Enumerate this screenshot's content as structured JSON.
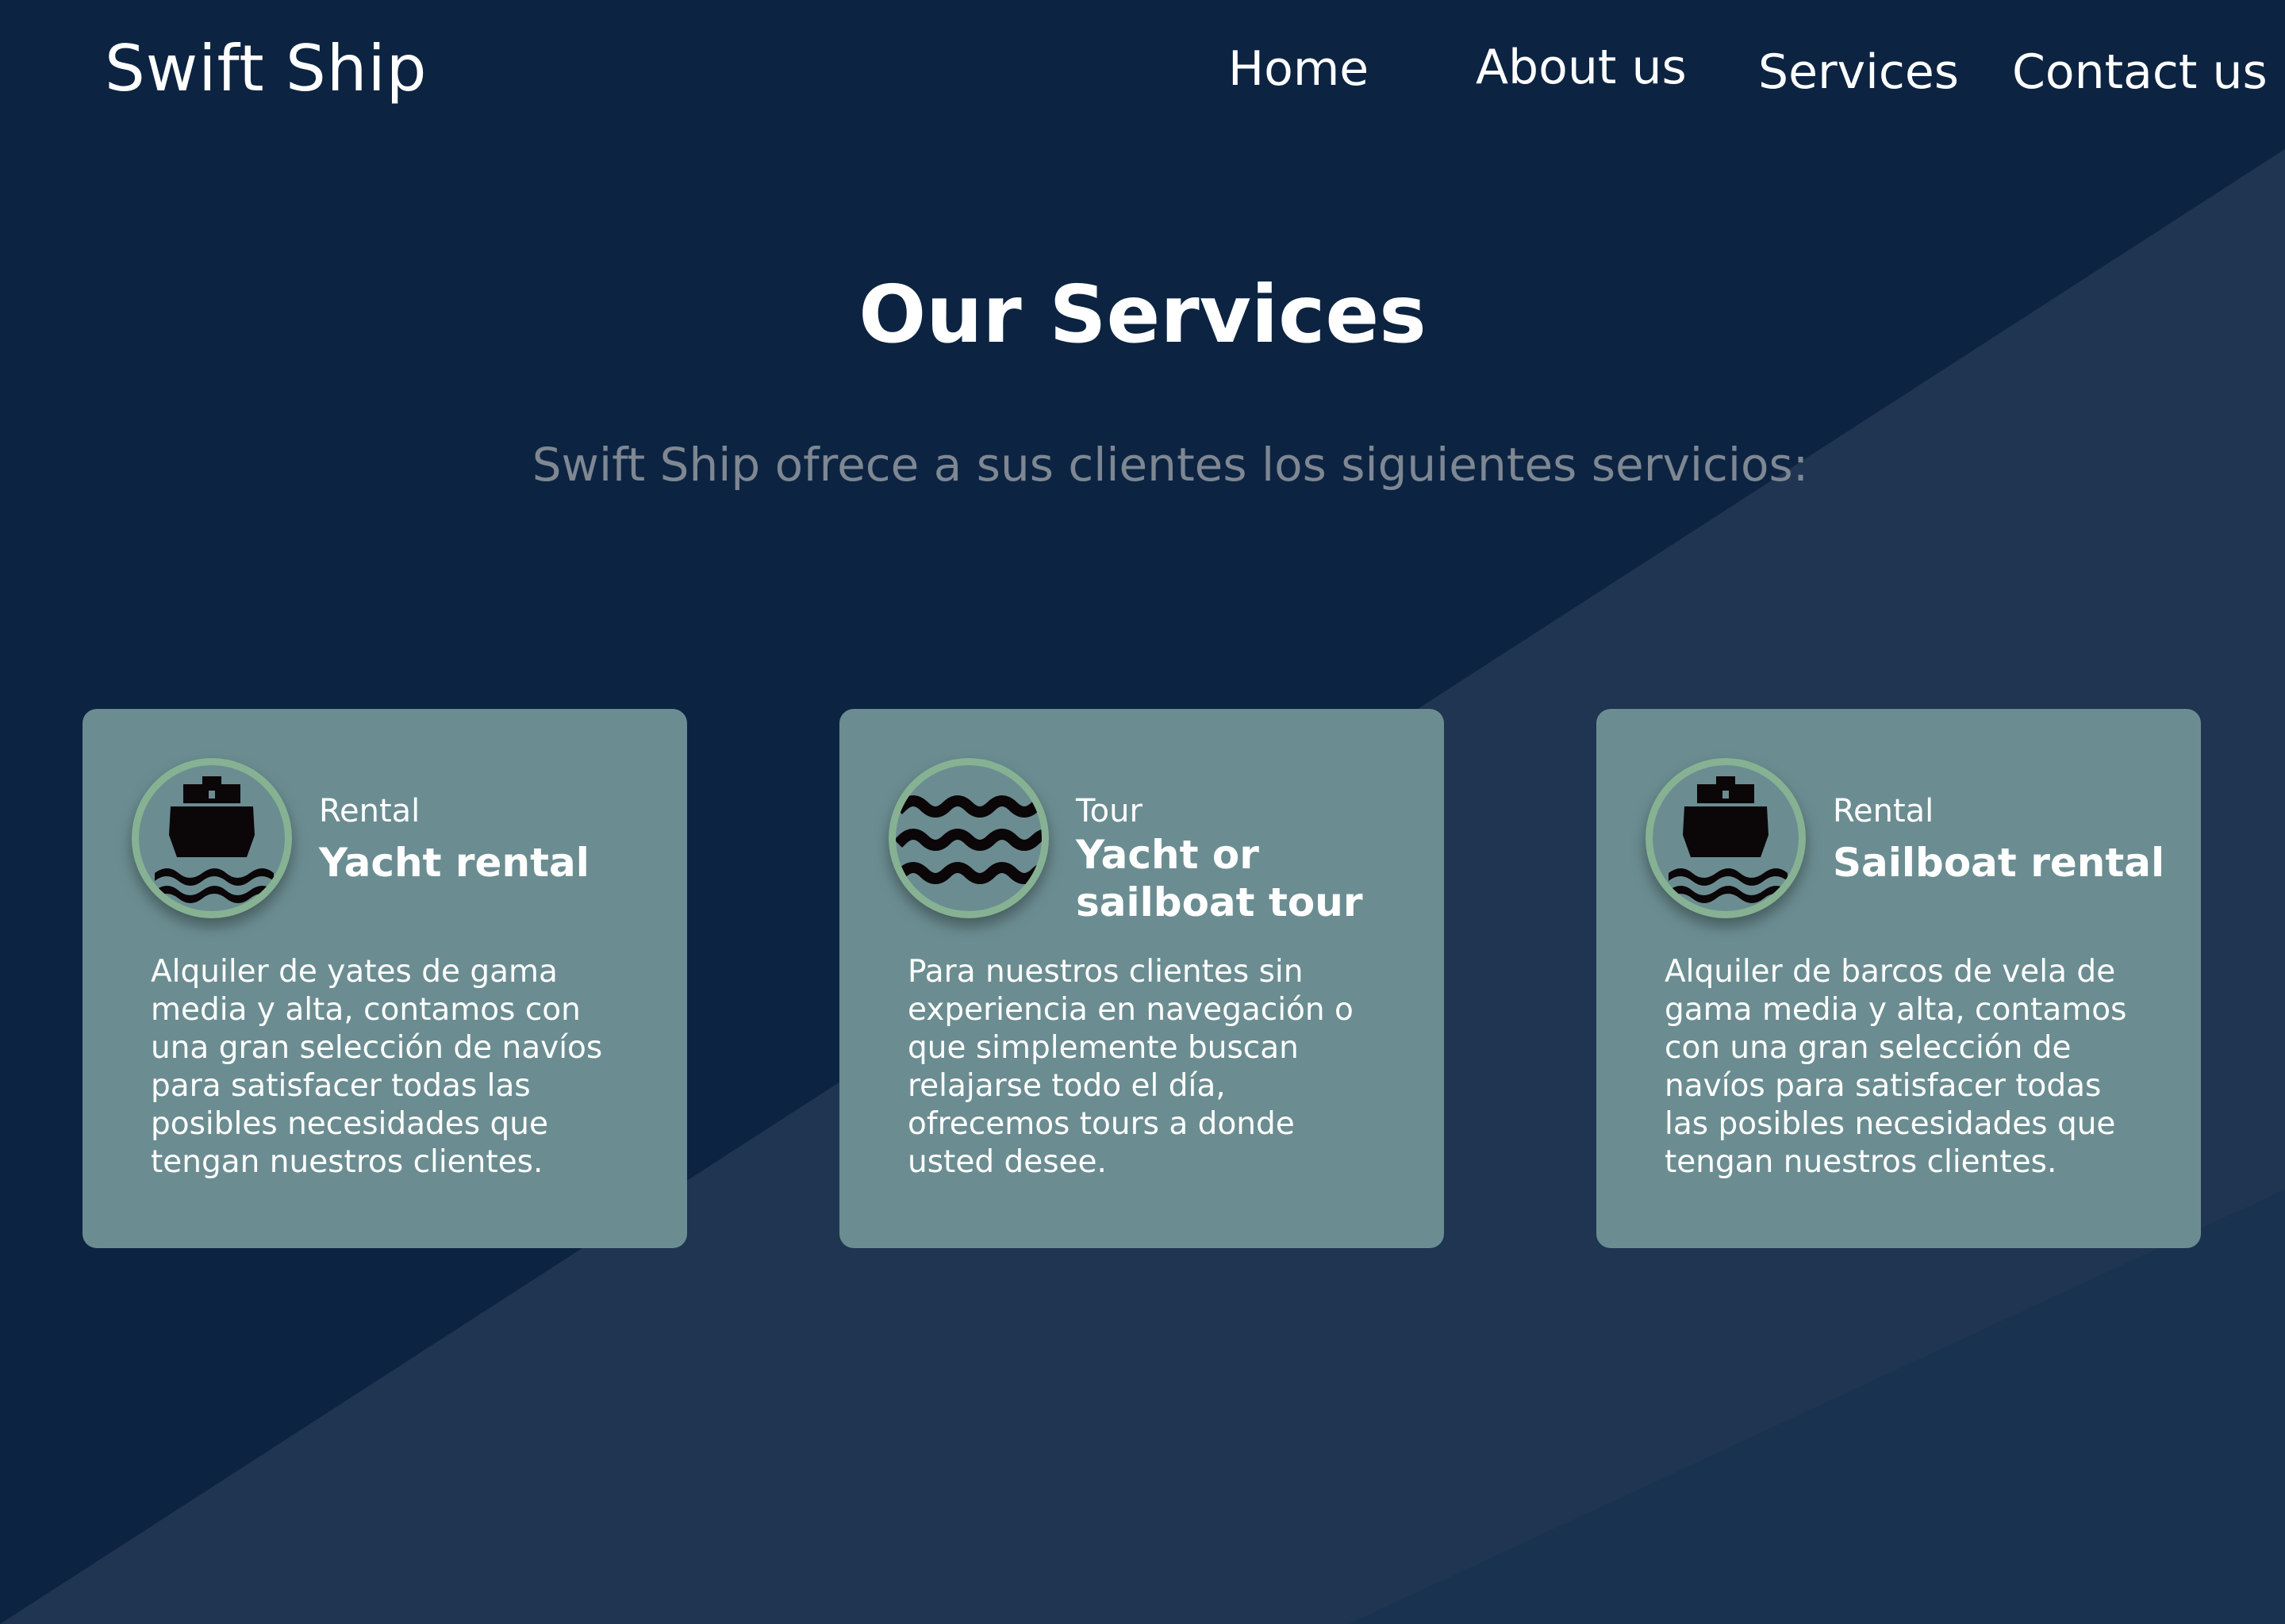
{
  "brand": {
    "name": "Swift Ship"
  },
  "nav": {
    "items": [
      "Home",
      "About us",
      "Services",
      "Contact us"
    ]
  },
  "colors": {
    "background": "#0c2442",
    "background_light": "#1f3551",
    "card": "#6b8d91",
    "icon_ring": "#86b293",
    "subtitle": "#7e8792"
  },
  "section": {
    "title": "Our Services",
    "subtitle": "Swift Ship ofrece a sus clientes los siguientes servicios:"
  },
  "cards": [
    {
      "icon": "ship-icon",
      "category": "Rental",
      "title": "Yacht rental",
      "description": "Alquiler de yates de gama media y alta, contamos con una gran selección de navíos para satisfacer todas las posibles necesidades que tengan nuestros clientes."
    },
    {
      "icon": "waves-icon",
      "category": "Tour",
      "title": "Yacht or sailboat tour",
      "description": "Para nuestros clientes sin experiencia en navegación o que simplemente buscan relajarse todo el día, ofrecemos tours a donde usted desee."
    },
    {
      "icon": "ship-icon",
      "category": "Rental",
      "title": "Sailboat rental",
      "description": "Alquiler de barcos de vela de gama media y alta, contamos con una gran selección de navíos para satisfacer todas las posibles necesidades que tengan nuestros clientes."
    }
  ]
}
